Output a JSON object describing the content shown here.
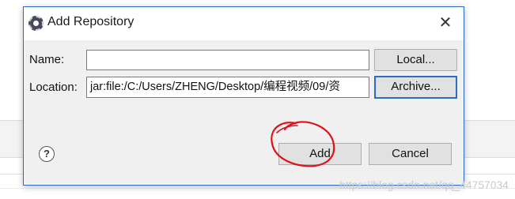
{
  "dialog": {
    "title": "Add Repository",
    "close_glyph": "✕",
    "name_label": "Name:",
    "name_value": "",
    "location_label": "Location:",
    "location_value": "jar:file:/C:/Users/ZHENG/Desktop/编程视频/09/资",
    "local_button": "Local...",
    "archive_button": "Archive...",
    "add_button": "Add",
    "cancel_button": "Cancel",
    "help_glyph": "?"
  },
  "watermark": "https://blog.csdn.net/qq_44757034",
  "colors": {
    "accent": "#2b6cc4",
    "annotation": "#e0101a"
  },
  "icons": [
    "app-icon",
    "close-icon",
    "help-icon"
  ]
}
